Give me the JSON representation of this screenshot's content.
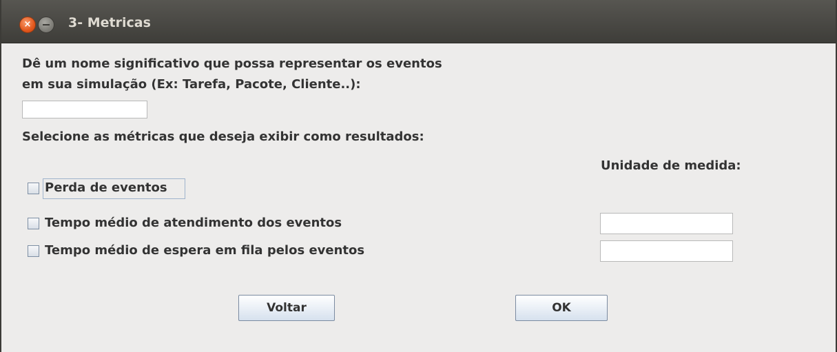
{
  "window": {
    "title": "3- Metricas"
  },
  "form": {
    "name_prompt_line1": "Dê um nome significativo que possa representar os eventos",
    "name_prompt_line2": "em sua simulação (Ex: Tarefa, Pacote, Cliente..):",
    "name_value": "",
    "metrics_prompt": "Selecione as métricas que deseja exibir como resultados:",
    "unit_header": "Unidade de medida:"
  },
  "metrics": [
    {
      "label": "Perda de eventos",
      "checked": false
    },
    {
      "label": "Tempo médio de atendimento dos eventos",
      "checked": false,
      "unit": ""
    },
    {
      "label": "Tempo médio de espera em fila pelos eventos",
      "checked": false,
      "unit": ""
    }
  ],
  "buttons": {
    "back": "Voltar",
    "ok": "OK"
  },
  "icons": {
    "close": "close-icon",
    "minimize": "minimize-icon"
  },
  "colors": {
    "titlebar": "#3e3d39",
    "close_button": "#e2571c",
    "window_background": "#edeceb"
  }
}
